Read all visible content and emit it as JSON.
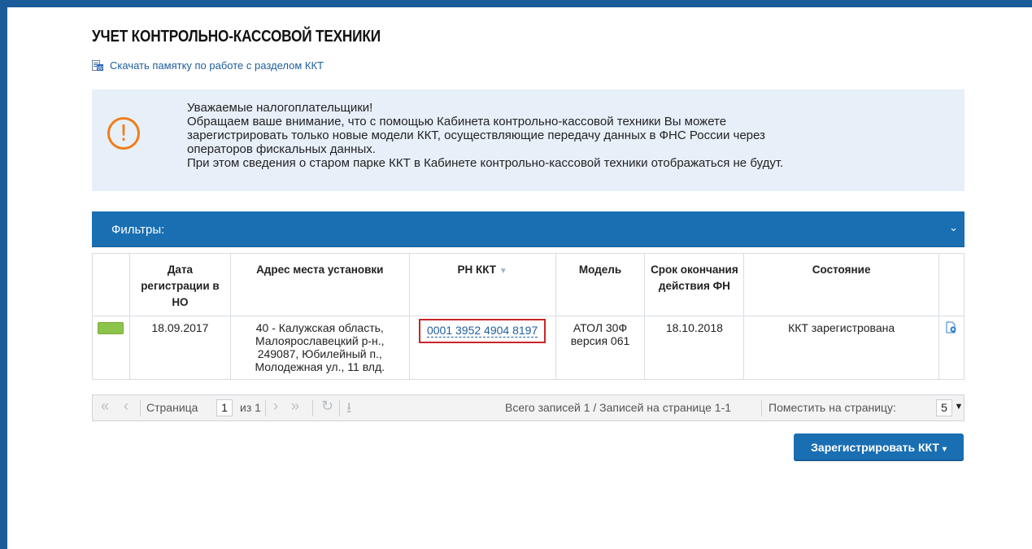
{
  "page": {
    "title": "УЧЕТ КОНТРОЛЬНО-КАССОВОЙ ТЕХНИКИ",
    "download_link": "Скачать памятку по работе с разделом ККТ"
  },
  "notice": {
    "lines": [
      "Уважаемые налогоплательщики!",
      "Обращаем ваше внимание, что с помощью Кабинета контрольно-кассовой техники Вы можете",
      "зарегистрировать только новые модели ККТ, осуществляющие передачу данных в ФНС России через",
      "операторов фискальных данных.",
      "При этом сведения о старом парке ККТ в Кабинете контрольно-кассовой техники отображаться не будут."
    ],
    "icon": "!"
  },
  "filters": {
    "label": "Фильтры:",
    "chevron": "⌄"
  },
  "table": {
    "headers": {
      "date": "Дата регистрации в НО",
      "address": "Адрес места установки",
      "rn": "РН ККТ",
      "model": "Модель",
      "fn_expiry": "Срок окончания действия ФН",
      "state": "Состояние"
    },
    "rows": [
      {
        "date": "18.09.2017",
        "address": "40 - Калужская область, Малоярославецкий р-н., 249087, Юбилейный п., Молодежная ул., 11 влд.",
        "rn": "0001 3952 4904 8197",
        "model": "АТОЛ 30Ф версия 061",
        "fn_expiry": "18.10.2018",
        "state": "ККТ зарегистрована"
      }
    ],
    "status_color": "#8cc34a"
  },
  "pager": {
    "page_label": "Страница",
    "page_value": "1",
    "of_label": "из 1",
    "summary": "Всего записей 1 / Записей на странице 1-1",
    "per_page_label": "Поместить на страницу:",
    "per_page_value": "5"
  },
  "actions": {
    "register": "Зарегистрировать ККТ"
  },
  "colors": {
    "brand": "#1a6fb3",
    "notice_bg": "#e7f0f9",
    "warning": "#f07d1a",
    "highlight_border": "#c8262a"
  }
}
